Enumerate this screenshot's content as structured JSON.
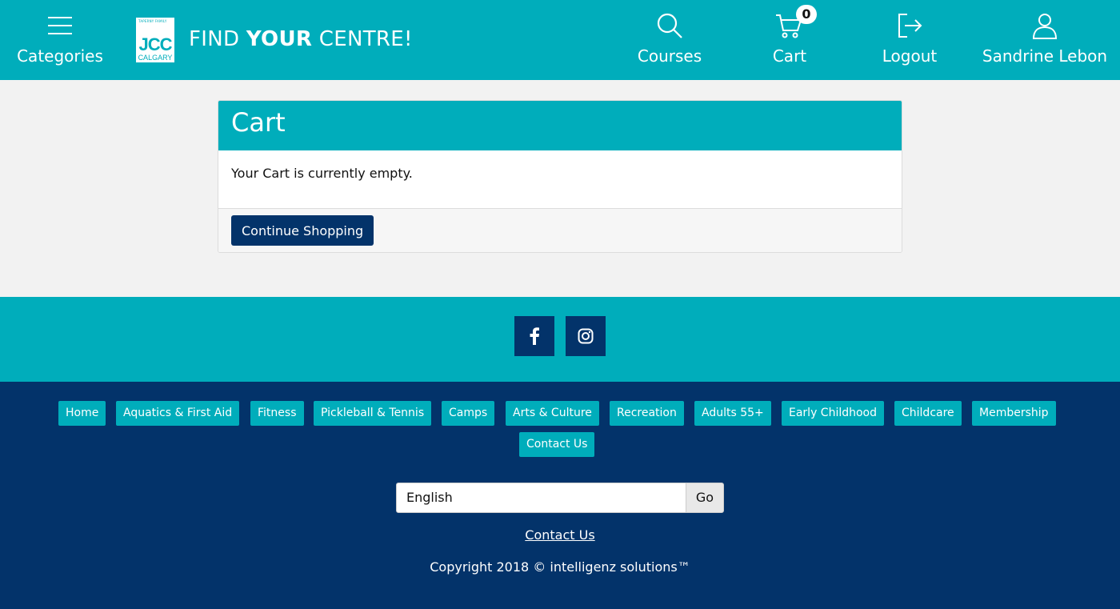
{
  "header": {
    "categories_label": "Categories",
    "tagline_prefix": "FIND ",
    "tagline_bold": "YOUR",
    "tagline_suffix": " CENTRE!",
    "logo": {
      "top": "TAPERNY FAMILY",
      "main": "JCC",
      "sub": "CALGARY"
    },
    "nav": {
      "courses": "Courses",
      "cart": "Cart",
      "cart_count": "0",
      "logout": "Logout",
      "user": "Sandrine Lebon"
    },
    "colors": {
      "brand": "#00adbb",
      "navy": "#03336a"
    }
  },
  "cart": {
    "title": "Cart",
    "message": "Your Cart is currently empty.",
    "continue_label": "Continue Shopping"
  },
  "social": {
    "icons": [
      "facebook-icon",
      "instagram-icon"
    ]
  },
  "footer": {
    "links": [
      "Home",
      "Aquatics & First Aid",
      "Fitness",
      "Pickleball & Tennis",
      "Camps",
      "Arts & Culture",
      "Recreation",
      "Adults 55+",
      "Early Childhood",
      "Childcare",
      "Membership",
      "Contact Us"
    ],
    "language": "English",
    "go_label": "Go",
    "contact_label": "Contact Us",
    "copyright": "Copyright 2018 © intelligenz solutions™"
  }
}
